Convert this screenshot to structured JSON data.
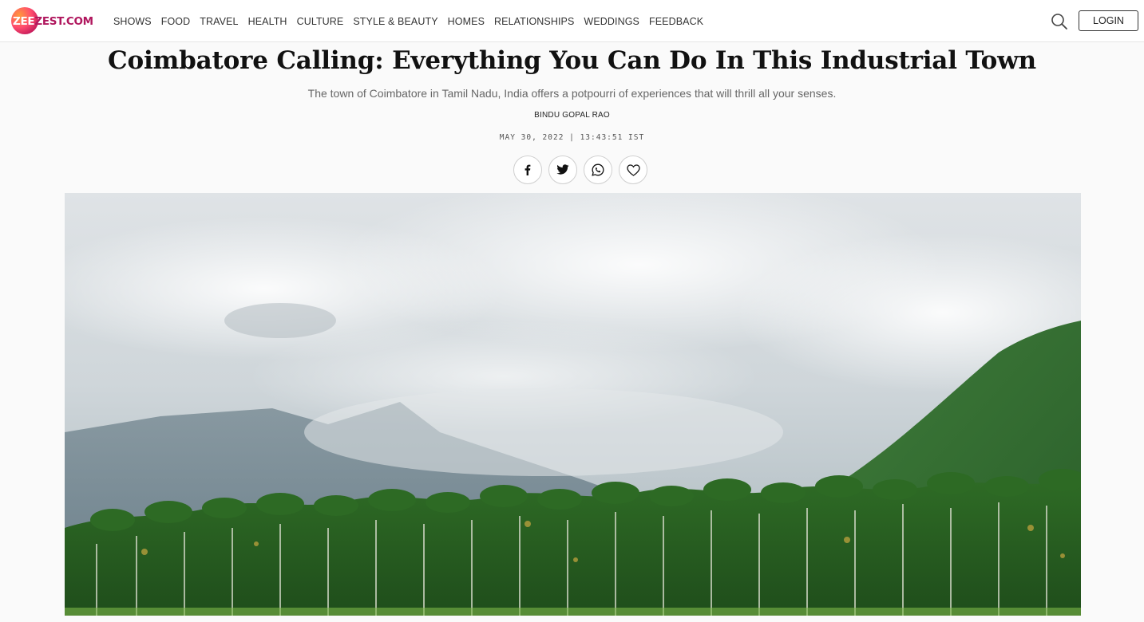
{
  "header": {
    "logo_text_white": "ZEE",
    "logo_text_colored": "ZEST.COM",
    "nav": [
      {
        "label": "SHOWS"
      },
      {
        "label": "FOOD"
      },
      {
        "label": "TRAVEL"
      },
      {
        "label": "HEALTH"
      },
      {
        "label": "CULTURE"
      },
      {
        "label": "STYLE & BEAUTY"
      },
      {
        "label": "HOMES"
      },
      {
        "label": "RELATIONSHIPS"
      },
      {
        "label": "WEDDINGS"
      },
      {
        "label": "FEEDBACK"
      }
    ],
    "login_label": "LOGIN",
    "search_icon": "search-icon"
  },
  "article": {
    "title": "Coimbatore Calling: Everything You Can Do In This Industrial Town",
    "subtitle": "The town of Coimbatore in Tamil Nadu, India offers a potpourri of experiences that will thrill all your senses.",
    "author": "BINDU GOPAL RAO",
    "date": "MAY 30, 2022 | 13:43:51 IST",
    "share": [
      {
        "icon": "facebook-icon"
      },
      {
        "icon": "twitter-icon"
      },
      {
        "icon": "whatsapp-icon"
      },
      {
        "icon": "heart-icon"
      }
    ]
  },
  "colors": {
    "brand": "#b0175e",
    "text": "#111111",
    "muted": "#666666"
  }
}
